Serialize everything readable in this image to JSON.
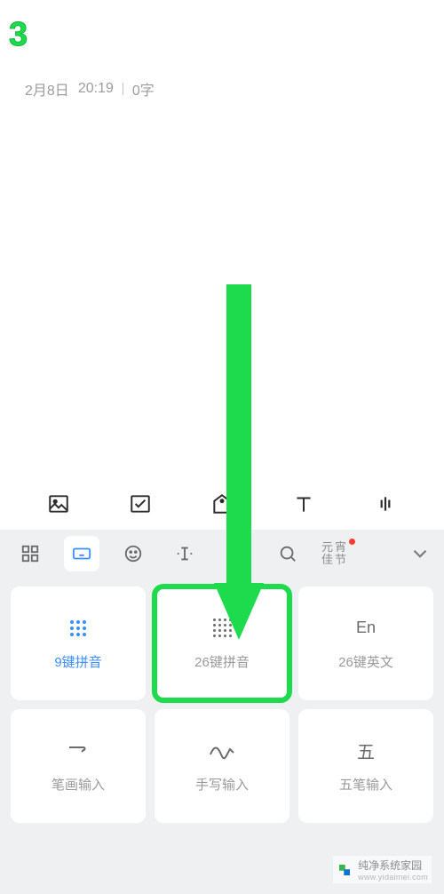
{
  "step_number": "3",
  "meta": {
    "date": "2月8日",
    "time": "20:19",
    "word_count": "0字"
  },
  "editor_toolbar": {
    "items": [
      {
        "name": "image-icon"
      },
      {
        "name": "checkbox-icon"
      },
      {
        "name": "tag-icon"
      },
      {
        "name": "text-icon"
      },
      {
        "name": "voice-icon"
      }
    ]
  },
  "kb_tabs": {
    "items": [
      {
        "name": "layout-grid-icon",
        "active": false
      },
      {
        "name": "keyboard-icon",
        "active": true
      },
      {
        "name": "emoji-icon",
        "active": false
      },
      {
        "name": "cursor-icon",
        "active": false
      },
      {
        "name": "clipboard-icon",
        "active": false
      },
      {
        "name": "search-icon",
        "active": false
      }
    ],
    "promo_label": "元宵\n佳节",
    "promo_line1": "元宵",
    "promo_line2": "佳节",
    "chevron": "chevron-down-icon"
  },
  "kb_cards": [
    {
      "id": "pinyin-9",
      "label": "9键拼音",
      "icon": "keypad-9-icon",
      "accent": true,
      "focus": false
    },
    {
      "id": "pinyin-26",
      "label": "26键拼音",
      "icon": "keypad-26-icon",
      "accent": false,
      "focus": true
    },
    {
      "id": "english-26",
      "label": "26键英文",
      "icon_text": "En",
      "accent": false,
      "focus": false
    },
    {
      "id": "stroke",
      "label": "笔画输入",
      "icon": "stroke-icon",
      "accent": false,
      "focus": false
    },
    {
      "id": "handwrite",
      "label": "手写输入",
      "icon": "handwrite-icon",
      "accent": false,
      "focus": false
    },
    {
      "id": "wubi",
      "label": "五笔输入",
      "icon_text": "五",
      "accent": false,
      "focus": false
    }
  ],
  "watermark": {
    "title": "纯净系统家园",
    "sub": "www.yidaimei.com"
  }
}
